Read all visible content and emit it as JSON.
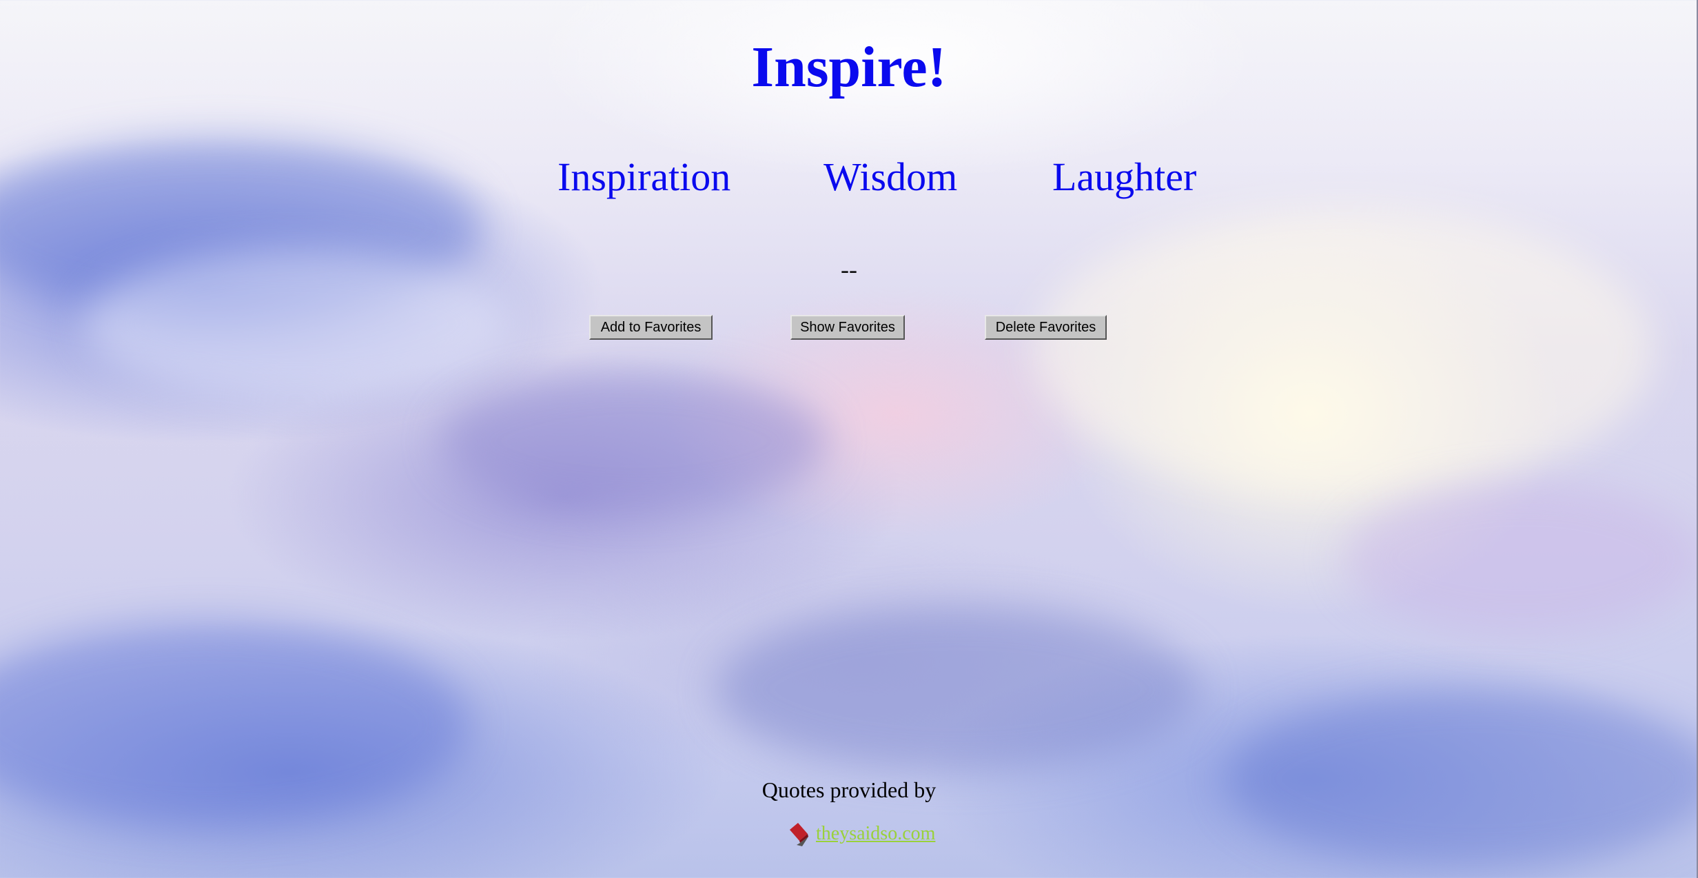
{
  "page": {
    "title": "Inspire!"
  },
  "categories": [
    {
      "label": "Inspiration"
    },
    {
      "label": "Wisdom"
    },
    {
      "label": "Laughter"
    }
  ],
  "quote": {
    "text": "--"
  },
  "buttons": {
    "add_favorites": "Add to Favorites",
    "show_favorites": "Show Favorites",
    "delete_favorites": "Delete Favorites"
  },
  "footer": {
    "provided_by": "Quotes provided by",
    "link_text": "theysaidso.com",
    "logo_icon": "quote-book-icon"
  },
  "colors": {
    "title": "#0a0aee",
    "link": "#9ad13a",
    "button_bg": "#c4c4c4",
    "logo_red": "#c0202a"
  }
}
